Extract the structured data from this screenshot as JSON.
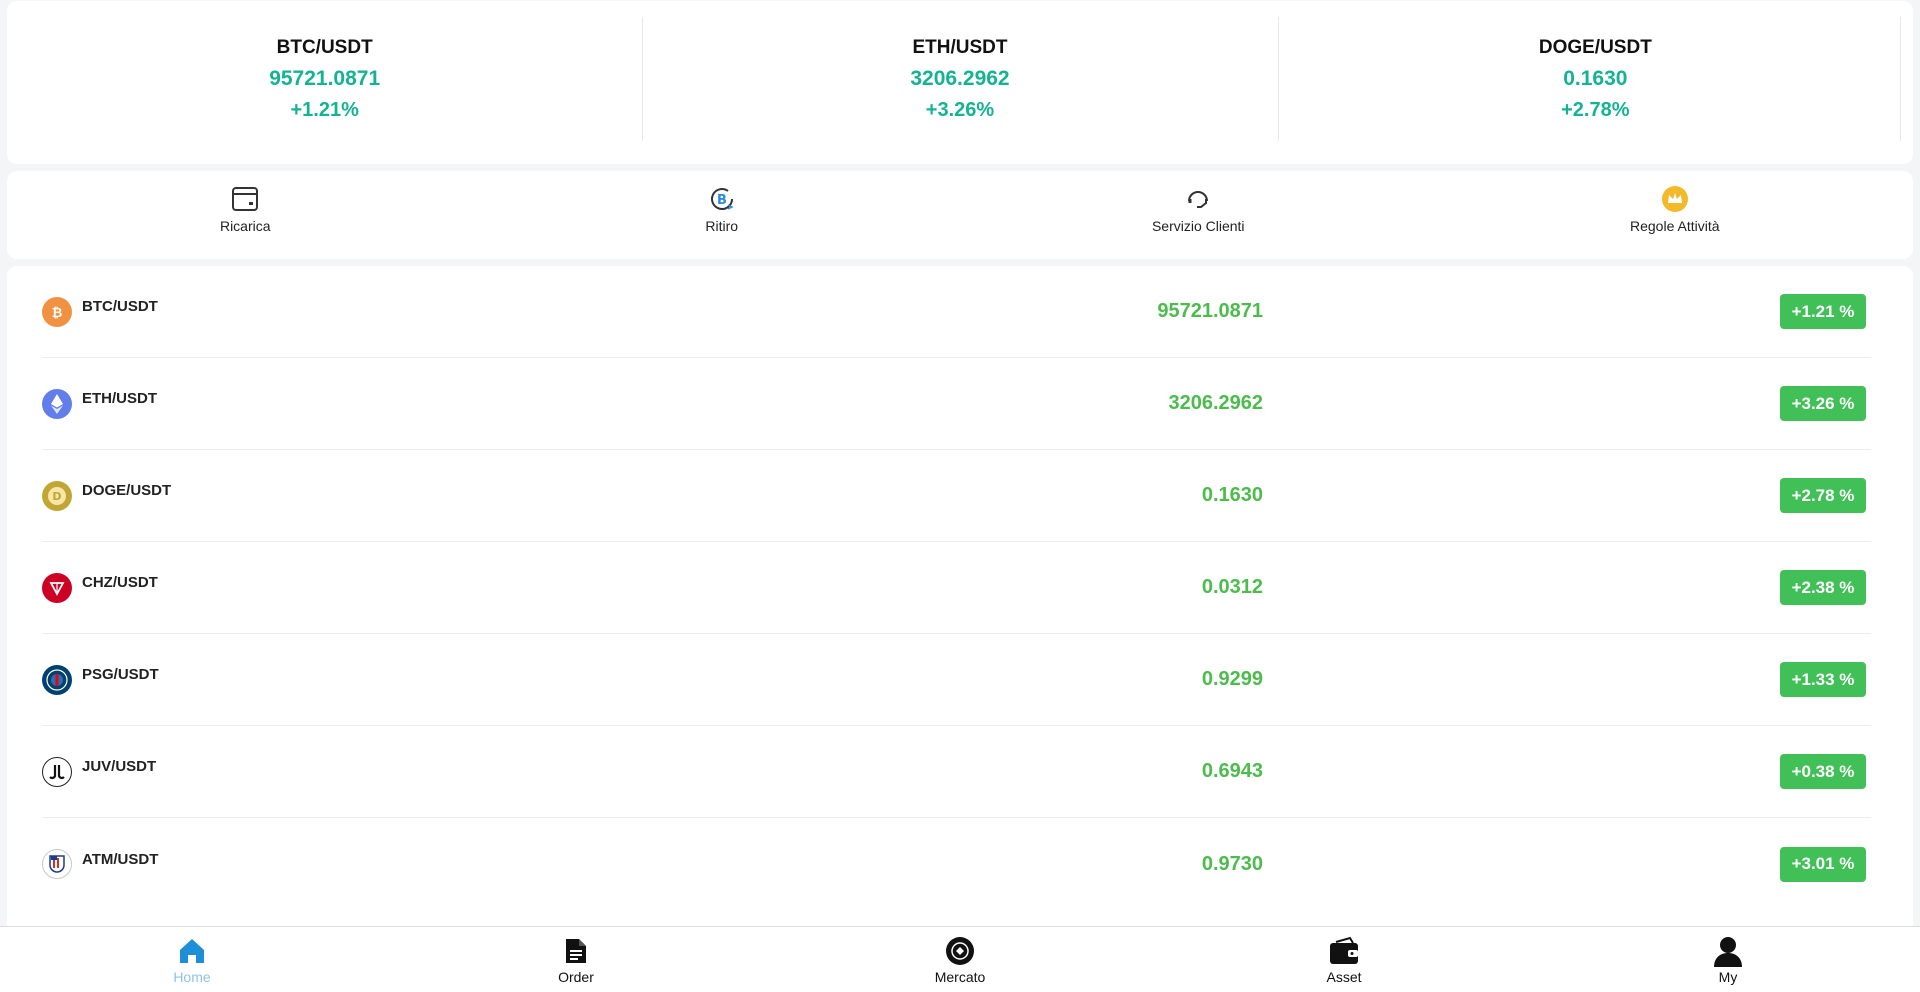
{
  "tickers": [
    {
      "symbol": "BTC/USDT",
      "price": "95721.0871",
      "change": "+1.21%"
    },
    {
      "symbol": "ETH/USDT",
      "price": "3206.2962",
      "change": "+3.26%"
    },
    {
      "symbol": "DOGE/USDT",
      "price": "0.1630",
      "change": "+2.78%"
    }
  ],
  "quick_actions": [
    {
      "label": "Ricarica",
      "icon": "wallet-card-icon"
    },
    {
      "label": "Ritiro",
      "icon": "bitcoin-withdraw-icon"
    },
    {
      "label": "Servizio Clienti",
      "icon": "headset-icon"
    },
    {
      "label": "Regole Attività",
      "icon": "crown-icon"
    }
  ],
  "market": [
    {
      "symbol": "BTC/USDT",
      "price": "95721.0871",
      "change": "+1.21 %",
      "icon": "btc-icon",
      "color": "#f09242"
    },
    {
      "symbol": "ETH/USDT",
      "price": "3206.2962",
      "change": "+3.26 %",
      "icon": "eth-icon",
      "color": "#627eea"
    },
    {
      "symbol": "DOGE/USDT",
      "price": "0.1630",
      "change": "+2.78 %",
      "icon": "doge-icon",
      "color": "#c2a633"
    },
    {
      "symbol": "CHZ/USDT",
      "price": "0.0312",
      "change": "+2.38 %",
      "icon": "chz-icon",
      "color": "#cd0124"
    },
    {
      "symbol": "PSG/USDT",
      "price": "0.9299",
      "change": "+1.33 %",
      "icon": "psg-icon",
      "color": "#004170"
    },
    {
      "symbol": "JUV/USDT",
      "price": "0.6943",
      "change": "+0.38 %",
      "icon": "juv-icon",
      "color": "#ffffff"
    },
    {
      "symbol": "ATM/USDT",
      "price": "0.9730",
      "change": "+3.01 %",
      "icon": "atm-icon",
      "color": "#ffffff"
    }
  ],
  "nav": [
    {
      "label": "Home",
      "icon": "home-icon",
      "active": true
    },
    {
      "label": "Order",
      "icon": "document-icon",
      "active": false
    },
    {
      "label": "Mercato",
      "icon": "market-icon",
      "active": false
    },
    {
      "label": "Asset",
      "icon": "wallet-icon",
      "active": false
    },
    {
      "label": "My",
      "icon": "user-icon",
      "active": false
    }
  ],
  "colors": {
    "up": "#13b393",
    "price_green": "#4cbc4c",
    "badge_green": "#40c057",
    "nav_active": "#8ec4e8",
    "home_icon": "#1e8fd6"
  }
}
